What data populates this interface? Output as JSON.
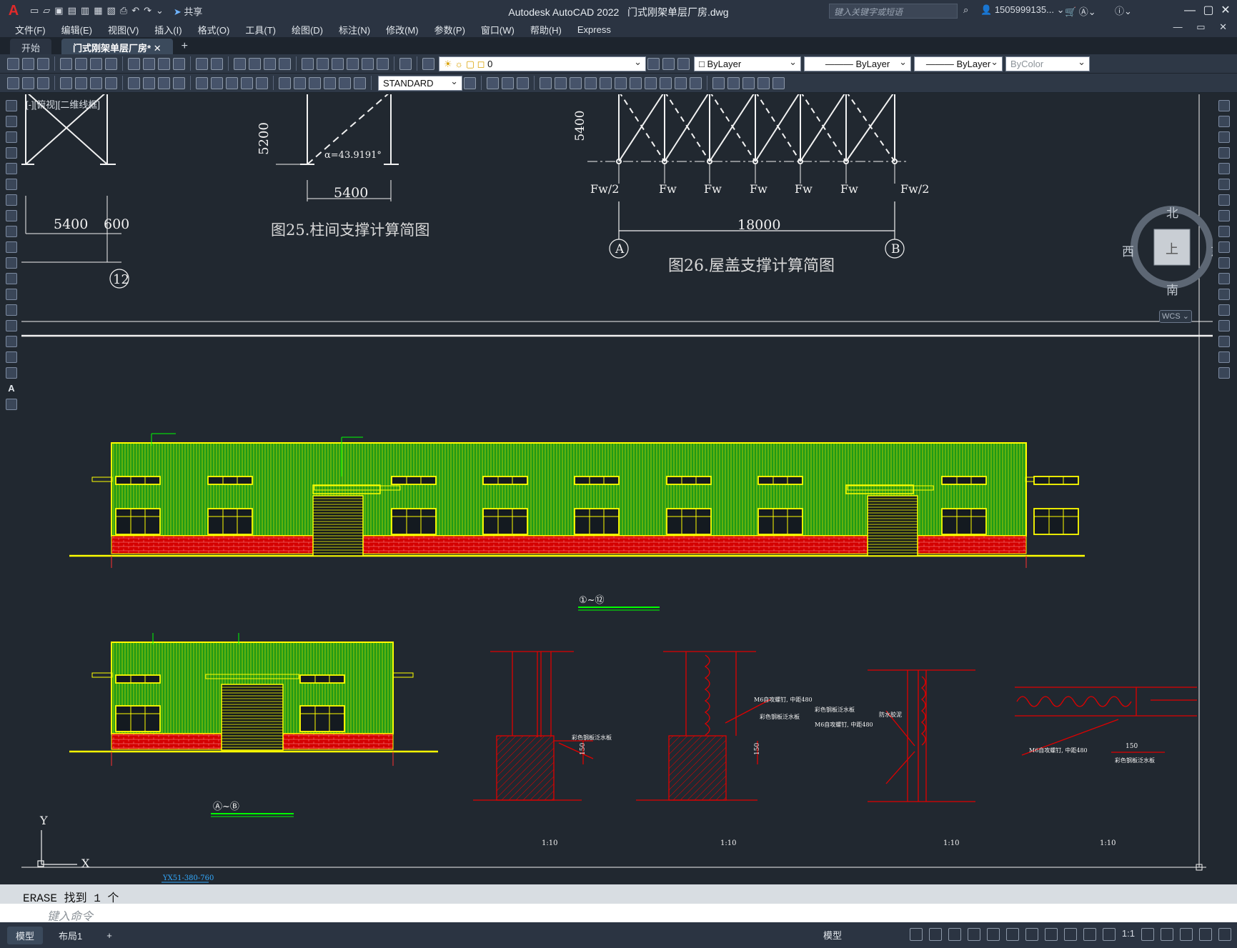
{
  "titlebar": {
    "app_title": "Autodesk AutoCAD 2022",
    "file_name": "门式刚架单层厂房.dwg",
    "share_label": "共享",
    "search_placeholder": "键入关键字或短语",
    "user_name": "1505999135...",
    "logo_letter": "A"
  },
  "menu": [
    "文件(F)",
    "编辑(E)",
    "视图(V)",
    "插入(I)",
    "格式(O)",
    "工具(T)",
    "绘图(D)",
    "标注(N)",
    "修改(M)",
    "参数(P)",
    "窗口(W)",
    "帮助(H)",
    "Express"
  ],
  "tabs": [
    "开始",
    "门式刚架单层厂房*"
  ],
  "toolbar": {
    "layer_value": "0",
    "color_value": "ByLayer",
    "linetype_value": "ByLayer",
    "lineweight_value": "ByLayer",
    "plotstyle_value": "ByColor",
    "textstyle_value": "STANDARD"
  },
  "viewport_label": "[-][俯视][二维线框]",
  "drawing": {
    "fig25_caption": "图25.柱间支撑计算简图",
    "fig26_caption": "图26.屋盖支撑计算简图",
    "dim_5200": "5200",
    "dim_5400_a": "5400",
    "dim_5400_b": "5400",
    "dim_5400_c": "5400",
    "dim_600": "600",
    "dim_18000": "18000",
    "angle_text": "α=43.9191°",
    "axis_12": "12",
    "axis_a": "A",
    "axis_b": "B",
    "loads": [
      "Fw/2",
      "Fw",
      "Fw",
      "Fw",
      "Fw",
      "Fw",
      "Fw/2"
    ],
    "elev_long_label": "①~⑫",
    "elev_short_label": "Ⓐ~Ⓑ",
    "scale_labels": [
      "1:10",
      "1:10",
      "1:10",
      "1:10"
    ],
    "detail_texts": [
      "彩色钢板泛水板",
      "M6自攻螺钉, 中距480",
      "彩色钢板泛水板",
      "M6自攻螺钉, 中距480",
      "彩色钢板泛水板",
      "防水胶泥",
      "M6自攻螺钉, 中距480",
      "彩色钢板泛水板"
    ],
    "detail_dim_150": "150",
    "bottom_label": "YX51-380-760",
    "axis_y": "Y",
    "axis_x": "X"
  },
  "viewcube": {
    "north": "北",
    "south": "南",
    "west": "西",
    "east": "东",
    "face": "上",
    "wcs": "WCS"
  },
  "command": {
    "history": "ERASE 找到 1 个",
    "placeholder": "键入命令"
  },
  "status": {
    "tab_model": "模型",
    "tab_layout": "布局1",
    "model_label": "模型",
    "scale": "1:1"
  }
}
